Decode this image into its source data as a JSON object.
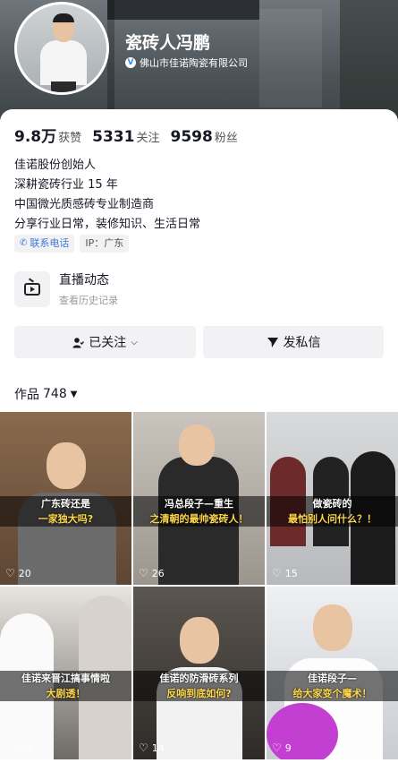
{
  "profile": {
    "name": "瓷砖人冯鹏",
    "company": "佛山市佳诺陶瓷有限公司",
    "verify_mark": "V"
  },
  "stats": [
    {
      "num": "9.8万",
      "label": "获赞"
    },
    {
      "num": "5331",
      "label": "关注"
    },
    {
      "num": "9598",
      "label": "粉丝"
    }
  ],
  "bio": {
    "line1": "佳诺股份创始人",
    "line2": "深耕瓷砖行业 15 年",
    "line3": "中国微光质感砖专业制造商",
    "line4": "分享行业日常，装修知识、生活日常"
  },
  "tags": {
    "contact": "联系电话",
    "ip": "IP：广东"
  },
  "live": {
    "title": "直播动态",
    "subtitle": "查看历史记录"
  },
  "buttons": {
    "followed": "已关注",
    "message": "发私信"
  },
  "works": {
    "label": "作品",
    "count": "748"
  },
  "videos": [
    {
      "line1": "广东砖还是",
      "line2": "一家独大吗?",
      "likes": "20"
    },
    {
      "line1": "冯总段子—重生",
      "line2": "之清朝的最帅瓷砖人！",
      "likes": "26"
    },
    {
      "line1": "做瓷砖的",
      "line2": "最怕别人问什么？！",
      "likes": "15"
    },
    {
      "line1": "佳诺来晋江搞事情啦",
      "line2": "大剧透！",
      "likes": "26"
    },
    {
      "line1": "佳诺的防滑砖系列",
      "line2": "反响到底如何?",
      "likes": "14"
    },
    {
      "line1": "佳诺段子—",
      "line2": "给大家变个魔术！",
      "likes": "9"
    }
  ]
}
